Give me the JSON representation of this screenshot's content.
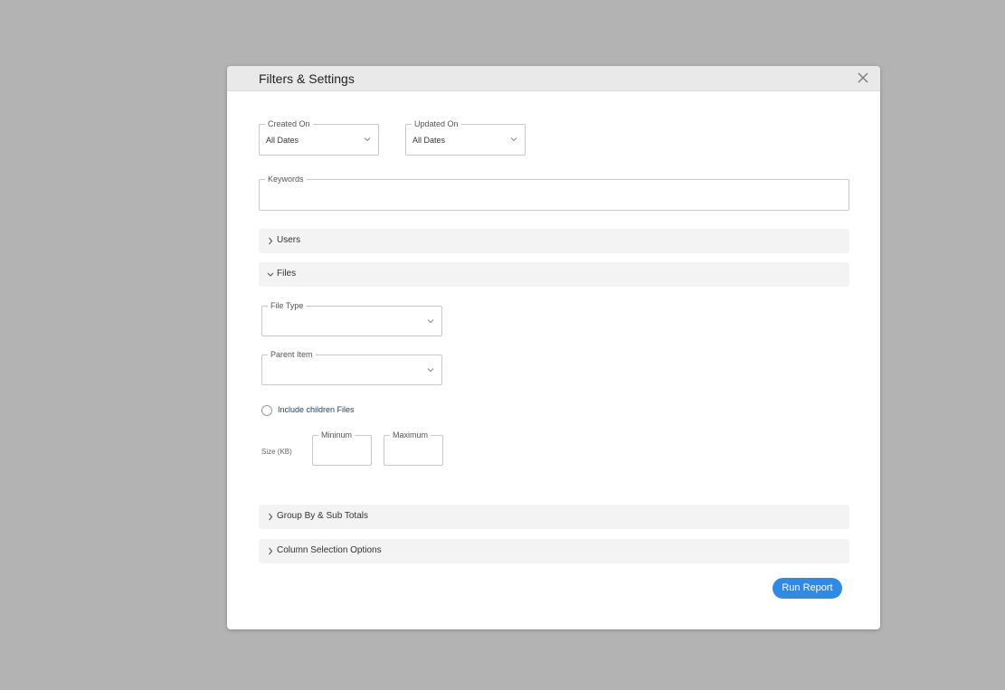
{
  "modal": {
    "title": "Filters & Settings",
    "close_icon": "close-icon"
  },
  "filters": {
    "created_on": {
      "label": "Created On",
      "value": "All Dates"
    },
    "updated_on": {
      "label": "Updated On",
      "value": "All Dates"
    },
    "keywords": {
      "label": "Keywords",
      "value": ""
    }
  },
  "sections": {
    "users": {
      "label": "Users",
      "expanded": false
    },
    "files": {
      "label": "Files",
      "expanded": true
    },
    "group_by": {
      "label": "Group By & Sub Totals",
      "expanded": false
    },
    "column_selection": {
      "label": "Column Selection Options",
      "expanded": false
    }
  },
  "files": {
    "file_type": {
      "label": "File Type",
      "value": ""
    },
    "parent_item": {
      "label": "Parent Item",
      "value": ""
    },
    "include_children": {
      "label": "Include children Files",
      "checked": false
    },
    "size": {
      "label": "Size (KB)",
      "minimum_label": "Mininum",
      "maximum_label": "Maximum"
    }
  },
  "actions": {
    "run_report": "Run Report"
  },
  "colors": {
    "backdrop": "#b3b3b3",
    "header": "#e9e9e9",
    "section_bar": "#f3f3f4",
    "primary_button": "#2f8ae5"
  }
}
